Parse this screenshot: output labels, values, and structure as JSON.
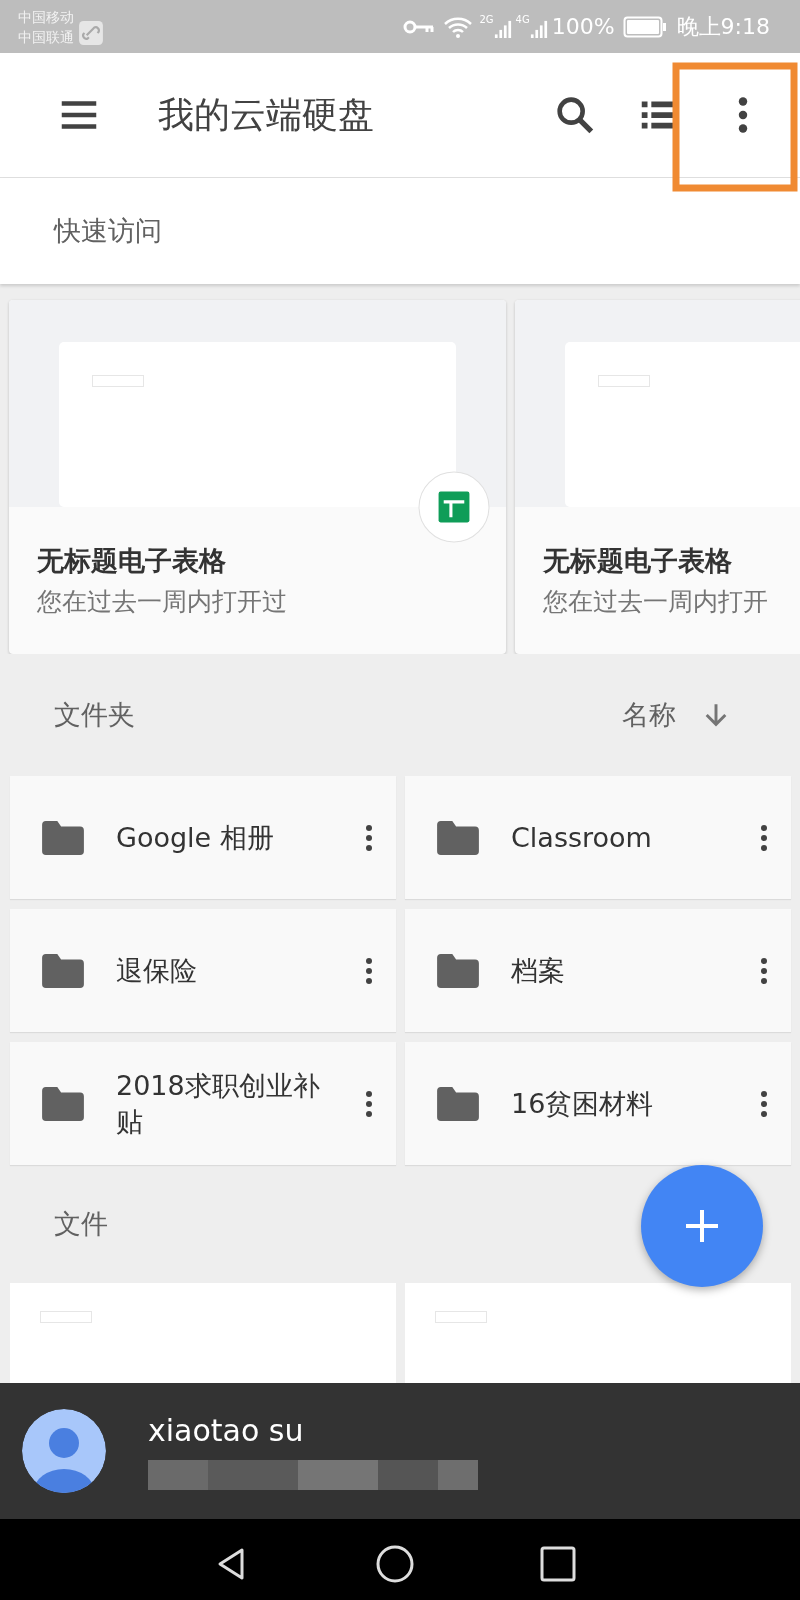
{
  "status_bar": {
    "carriers": [
      "中国移动",
      "中国联通"
    ],
    "signals": [
      "2G",
      "4G"
    ],
    "battery": "100%",
    "time": "晚上9:18"
  },
  "toolbar": {
    "title": "我的云端硬盘"
  },
  "quick_access": {
    "title": "快速访问",
    "cards": [
      {
        "title": "无标题电子表格",
        "subtitle": "您在过去一周内打开过"
      },
      {
        "title": "无标题电子表格",
        "subtitle": "您在过去一周内打开"
      }
    ]
  },
  "folders": {
    "title": "文件夹",
    "sort": "名称",
    "items": [
      {
        "name": "Google 相册"
      },
      {
        "name": "Classroom"
      },
      {
        "name": "退保险"
      },
      {
        "name": "档案"
      },
      {
        "name": "2018求职创业补贴"
      },
      {
        "name": "16贫困材料"
      }
    ]
  },
  "files": {
    "title": "文件",
    "items": [
      {
        "kind": "document"
      },
      {
        "kind": "document"
      }
    ]
  },
  "account": {
    "name": "xiaotao su"
  }
}
